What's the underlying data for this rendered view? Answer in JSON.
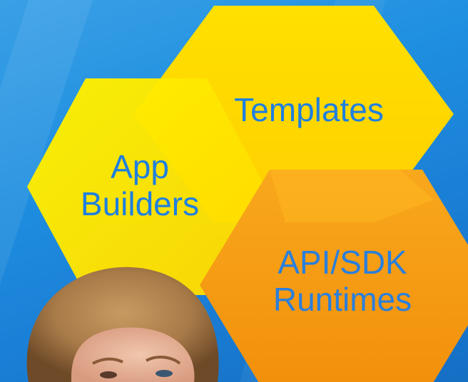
{
  "hexagons": {
    "templates": {
      "label": "Templates",
      "fill": "#ffd200"
    },
    "app_builders": {
      "line1": "App",
      "line2": "Builders",
      "fill": "#ffe81a"
    },
    "api_sdk": {
      "line1": "API/SDK",
      "line2": "Runtimes",
      "fill": "#f59a12"
    }
  },
  "colors": {
    "background": "#1f8fe0",
    "label_text": "#1e7fe0"
  }
}
